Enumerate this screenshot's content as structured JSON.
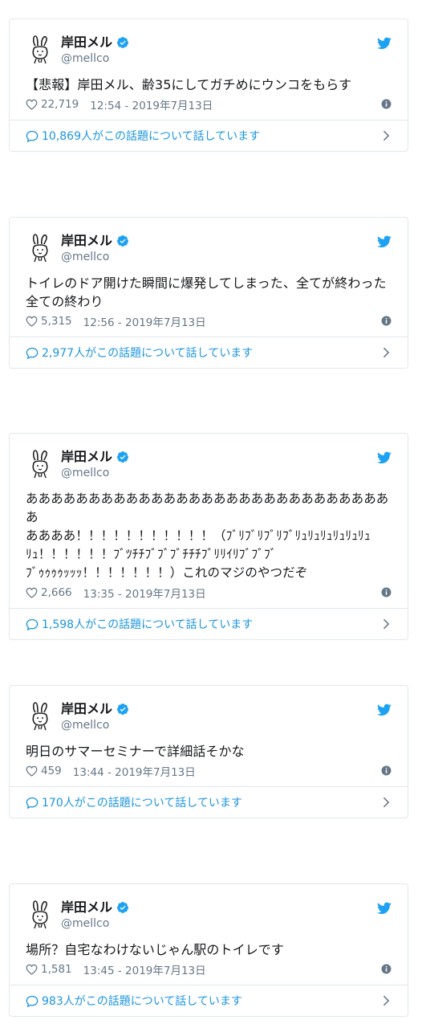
{
  "tweets": [
    {
      "display_name": "岸田メル",
      "handle": "@mellco",
      "text": "【悲報】岸田メル、齢35にしてガチめにウンコをもらす",
      "likes": "22,719",
      "timestamp": "12:54 - 2019年7月13日",
      "conversation": "10,869人がこの話題について話しています"
    },
    {
      "display_name": "岸田メル",
      "handle": "@mellco",
      "text": "トイレのドア開けた瞬間に爆発してしまった、全てが終わった\n全ての終わり",
      "likes": "5,315",
      "timestamp": "12:56 - 2019年7月13日",
      "conversation": "2,977人がこの話題について話しています"
    },
    {
      "display_name": "岸田メル",
      "handle": "@mellco",
      "text": "ああああああああああああああああああああああああああああああ\nああああ！！！！！！！！！！！（ﾌﾞﾘﾌﾞﾘﾌﾞﾘﾌﾞﾘｭﾘｭﾘｭﾘｭﾘｭﾘｭ\nﾘｭ！！！！！！ﾌﾞﾂﾁﾁﾌﾞﾌﾞﾌﾞﾁﾁﾁﾌﾞﾘﾘｲﾘﾌﾞﾌﾞﾌﾞ\nﾌﾞｩｩｩｩｯｯｯ！！！！！！！）これのマジのやつだぞ",
      "likes": "2,666",
      "timestamp": "13:35 - 2019年7月13日",
      "conversation": "1,598人がこの話題について話しています"
    },
    {
      "display_name": "岸田メル",
      "handle": "@mellco",
      "text": "明日のサマーセミナーで詳細話そかな",
      "likes": "459",
      "timestamp": "13:44 - 2019年7月13日",
      "conversation": "170人がこの話題について話しています"
    },
    {
      "display_name": "岸田メル",
      "handle": "@mellco",
      "text": "場所？自宅なわけないじゃん駅のトイレです",
      "likes": "1,581",
      "timestamp": "13:45 - 2019年7月13日",
      "conversation": "983人がこの話題について話しています"
    }
  ],
  "icons": {
    "avatar": "bunny-avatar-icon",
    "verified": "verified-badge-icon",
    "twitter": "twitter-bird-icon",
    "like": "heart-icon",
    "info": "info-icon",
    "reply": "speech-bubble-icon",
    "next": "chevron-right-icon"
  },
  "colors": {
    "accent": "#1da1f2",
    "link": "#1b95e0",
    "muted": "#657786",
    "border": "#e1e8ed"
  }
}
